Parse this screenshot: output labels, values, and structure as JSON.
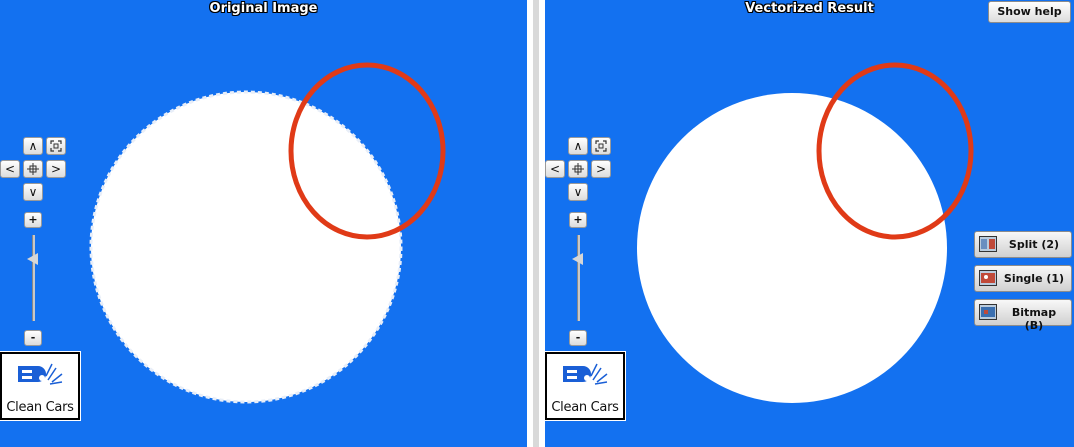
{
  "left_pane": {
    "title": "Original Image"
  },
  "right_pane": {
    "title": "Vectorized Result"
  },
  "nav": {
    "up": "∧",
    "down": "∨",
    "left": "<",
    "right": ">",
    "zoom_in": "+",
    "zoom_out": "-"
  },
  "logo": {
    "text": "Clean Cars"
  },
  "help_button": {
    "label": "Show help"
  },
  "view_buttons": [
    {
      "label": "Split (2)"
    },
    {
      "label": "Single (1)"
    },
    {
      "label": "Bitmap (B)"
    }
  ],
  "colors": {
    "background_blue": "#1371f0",
    "circle_white": "#ffffff",
    "annotation_red": "#e03a17"
  }
}
